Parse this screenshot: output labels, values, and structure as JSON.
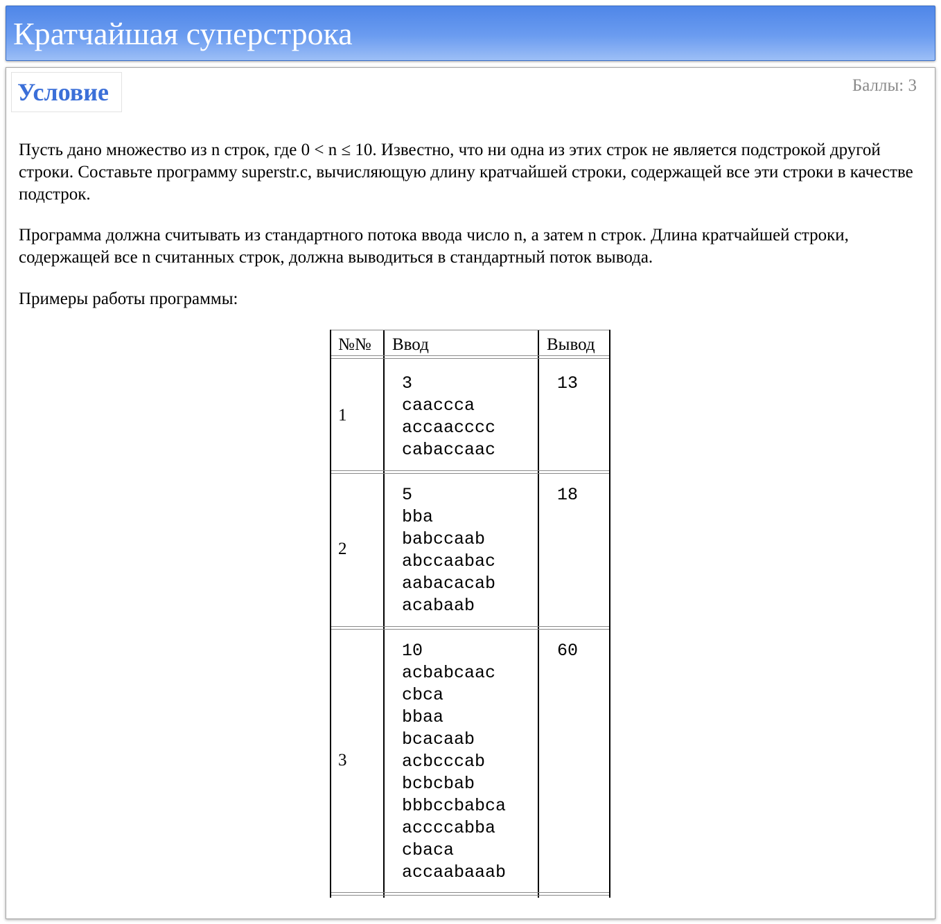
{
  "page_title": "Кратчайшая суперстрока",
  "section": {
    "title": "Условие",
    "score": "Баллы: 3"
  },
  "paragraphs": {
    "p1": "Пусть дано множество из n строк, где 0 < n ≤ 10. Известно, что ни одна из этих строк не является подстрокой другой строки. Составьте программу superstr.c, вычисляющую длину кратчайшей строки, содержащей все эти строки в качестве подстрок.",
    "p2": "Программа должна считывать из стандартного потока ввода число n, а затем n строк. Длина кратчайшей строки, содержащей все n считанных строк, должна выводиться в стандартный поток вывода.",
    "p3": "Примеры работы программы:"
  },
  "table": {
    "headers": {
      "num": "№№",
      "input": "Ввод",
      "output": "Вывод"
    },
    "rows": [
      {
        "num": "1",
        "input": "3\ncaaccca\naccaacccc\ncabaccaac",
        "output": "13"
      },
      {
        "num": "2",
        "input": "5\nbba\nbabccaab\nabccaabac\naabacacab\nacabaab",
        "output": "18"
      },
      {
        "num": "3",
        "input": "10\nacbabcaac\ncbca\nbbaa\nbcacaab\nacbcccab\nbcbcbab\nbbbccbabca\naccccabba\ncbaca\naccaabaaab",
        "output": "60"
      }
    ]
  }
}
